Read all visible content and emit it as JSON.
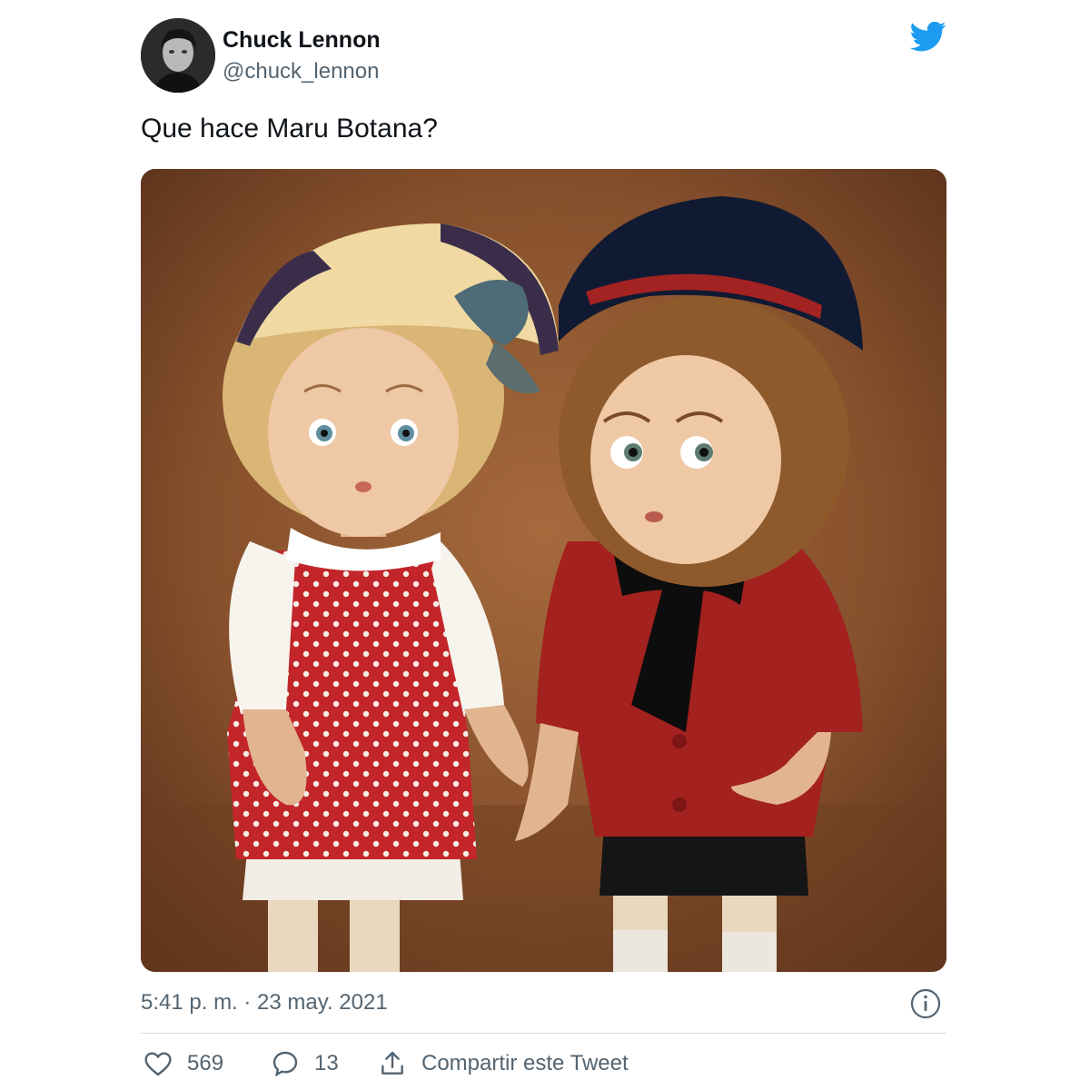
{
  "author": {
    "display_name": "Chuck Lennon",
    "handle": "@chuck_lennon"
  },
  "tweet": {
    "text": "Que hace Maru Botana?",
    "timestamp": "5:41 p. m. · 23 may. 2021"
  },
  "actions": {
    "likes": "569",
    "replies": "13",
    "share_label": "Compartir este Tweet"
  },
  "icons": {
    "brand": "twitter-bird-icon",
    "info": "info-icon",
    "like": "heart-icon",
    "reply": "comment-icon",
    "share": "share-icon"
  },
  "colors": {
    "brand": "#1d9bf0",
    "text": "#0f1419",
    "secondary_text": "#536471",
    "divider": "#cfd9de"
  }
}
